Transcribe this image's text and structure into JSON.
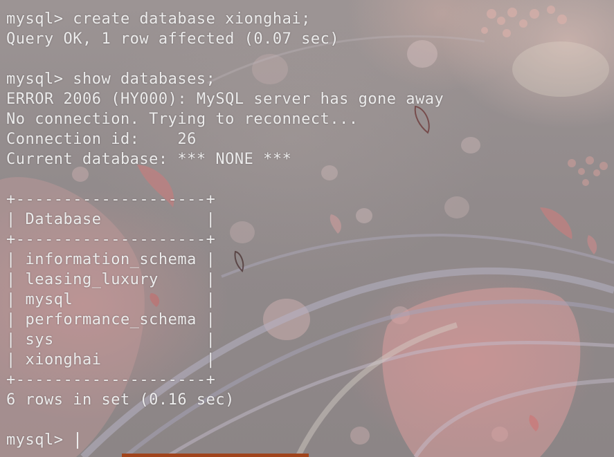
{
  "terminal": {
    "lines": [
      "mysql> create database xionghai;",
      "Query OK, 1 row affected (0.07 sec)",
      "",
      "mysql> show databases;",
      "ERROR 2006 (HY000): MySQL server has gone away",
      "No connection. Trying to reconnect...",
      "Connection id:    26",
      "Current database: *** NONE ***",
      "",
      "+--------------------+",
      "| Database           |",
      "+--------------------+",
      "| information_schema |",
      "| leasing_luxury     |",
      "| mysql              |",
      "| performance_schema |",
      "| sys                |",
      "| xionghai           |",
      "+--------------------+",
      "6 rows in set (0.16 sec)",
      ""
    ],
    "prompt": "mysql> "
  },
  "colors": {
    "text": "#ececec",
    "background": "#918a8b",
    "taskbar_accent": "#a0441c"
  },
  "icons": {
    "cursor": "text-cursor-icon"
  }
}
